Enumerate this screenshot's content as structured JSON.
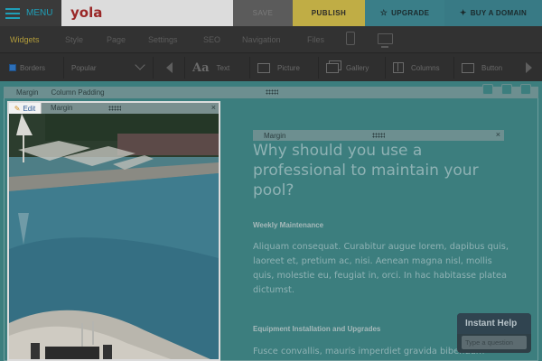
{
  "topbar": {
    "menu_label": "MENU",
    "logo_text": "yola",
    "save_label": "SAVE",
    "publish_label": "PUBLISH",
    "upgrade_label": "UPGRADE",
    "buy_domain_label": "BUY A DOMAIN"
  },
  "tabs": [
    {
      "label": "Widgets",
      "active": true
    },
    {
      "label": "Style",
      "active": false
    },
    {
      "label": "Page",
      "active": false
    },
    {
      "label": "Settings",
      "active": false
    },
    {
      "label": "SEO",
      "active": false
    },
    {
      "label": "Navigation",
      "active": false
    },
    {
      "label": "Files",
      "active": false
    }
  ],
  "widgetsbar": {
    "borders_label": "Borders",
    "borders_checked": true,
    "category_selected": "Popular",
    "widgets": [
      {
        "label": "Text",
        "icon": "text-icon"
      },
      {
        "label": "Picture",
        "icon": "picture-icon"
      },
      {
        "label": "Gallery",
        "icon": "gallery-icon"
      },
      {
        "label": "Columns",
        "icon": "columns-icon"
      },
      {
        "label": "Button",
        "icon": "button-icon"
      }
    ]
  },
  "canvas": {
    "outer_margin_label": "Margin",
    "column_padding_label": "Column Padding",
    "edit_label": "Edit",
    "image_margin_label": "Margin",
    "inner_margin_label": "Margin",
    "heading": "Why should you use a professional to maintain your pool?",
    "section1_title": "Weekly Maintenance",
    "section1_text": "Aliquam consequat. Curabitur augue lorem, dapibus quis, laoreet et, pretium ac, nisi. Aenean magna nisl, mollis quis, molestie eu, feugiat in, orci. In hac habitasse platea dictumst.",
    "section2_title": "Equipment Installation and Upgrades",
    "section2_text": "Fusce convallis, mauris imperdiet gravida bibendum"
  },
  "help": {
    "title": "Instant Help",
    "placeholder": "Type a question"
  },
  "colors": {
    "accent": "#1f9fb8",
    "publish": "#c0ad45",
    "canvas": "#3c7e7e",
    "logo": "#9a2727"
  }
}
